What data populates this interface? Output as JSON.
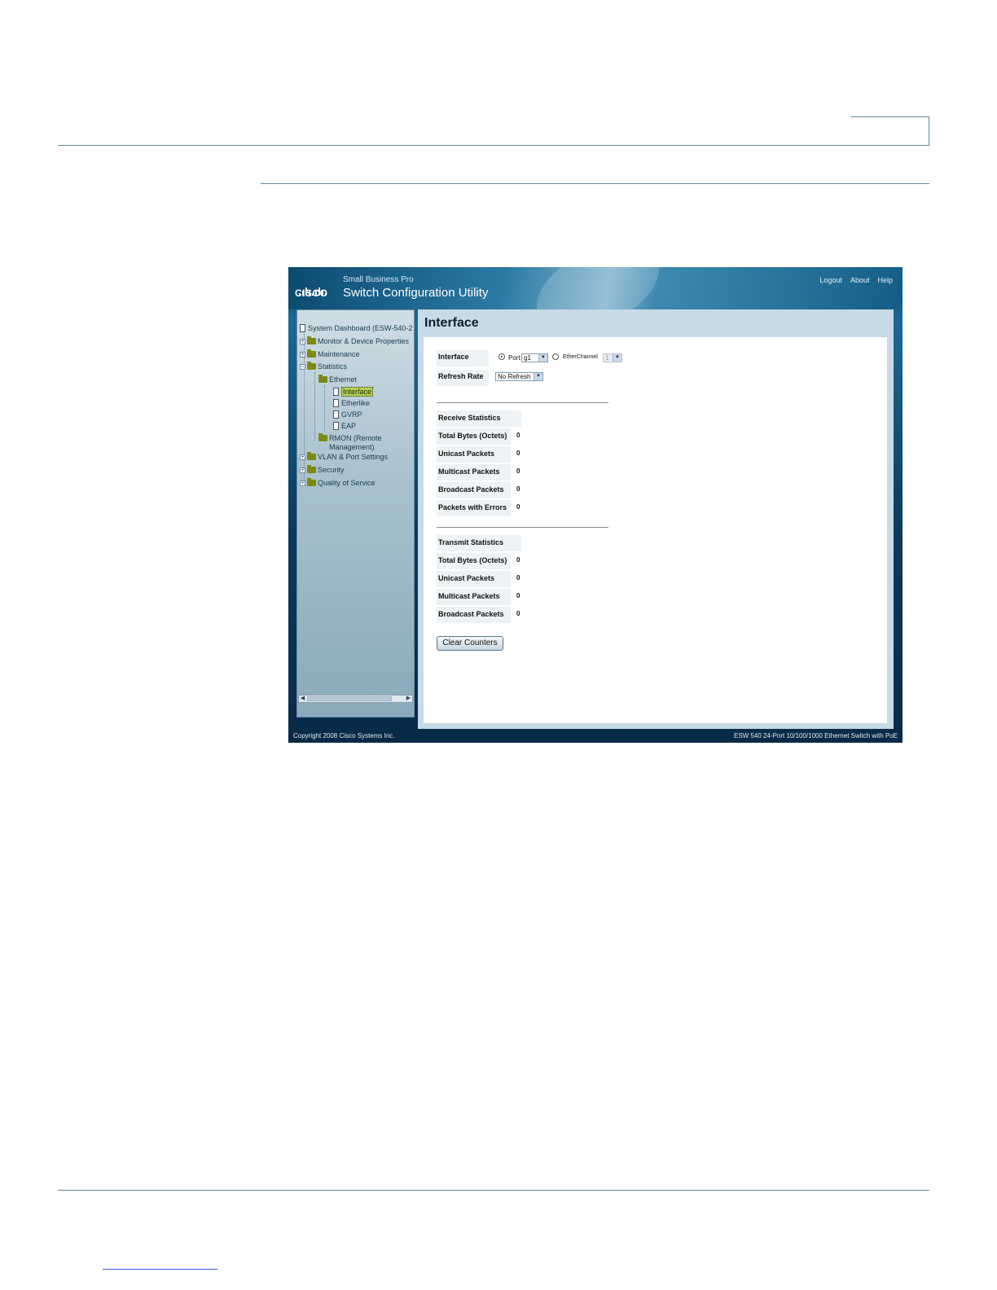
{
  "app": {
    "brand_small": "Small Business Pro",
    "brand_title": "Switch Configuration Utility",
    "logo_text": "CISCO",
    "top_links": [
      "Logout",
      "About",
      "Help"
    ]
  },
  "sidebar": {
    "root": "System Dashboard (ESW-540-2",
    "items": [
      {
        "label": "Monitor & Device Properties"
      },
      {
        "label": "Maintenance"
      },
      {
        "label": "Statistics"
      },
      {
        "label": "Ethernet"
      },
      {
        "label": "Interface"
      },
      {
        "label": "Etherlike"
      },
      {
        "label": "GVRP"
      },
      {
        "label": "EAP"
      },
      {
        "label": "RMON (Remote"
      },
      {
        "label": "Management)"
      },
      {
        "label": "VLAN & Port Settings"
      },
      {
        "label": "Security"
      },
      {
        "label": "Quality of Service"
      }
    ]
  },
  "main": {
    "title": "Interface",
    "interface_label": "Interface",
    "port_label": "Port",
    "port_value": "g1",
    "etherchannel_label": "EtherChannel",
    "etherchannel_value": "1",
    "refresh_label": "Refresh Rate",
    "refresh_value": "No Refresh",
    "receive": {
      "header": "Receive Statistics",
      "rows": [
        {
          "label": "Total Bytes (Octets)",
          "value": "0"
        },
        {
          "label": "Unicast Packets",
          "value": "0"
        },
        {
          "label": "Multicast Packets",
          "value": "0"
        },
        {
          "label": "Broadcast Packets",
          "value": "0"
        },
        {
          "label": "Packets with Errors",
          "value": "0"
        }
      ]
    },
    "transmit": {
      "header": "Transmit Statistics",
      "rows": [
        {
          "label": "Total Bytes (Octets)",
          "value": "0"
        },
        {
          "label": "Unicast Packets",
          "value": "0"
        },
        {
          "label": "Multicast Packets",
          "value": "0"
        },
        {
          "label": "Broadcast Packets",
          "value": "0"
        }
      ]
    },
    "clear_button": "Clear Counters"
  },
  "footer": {
    "copyright": "Copyright 2008 Cisco Systems Inc.",
    "model": "ESW 540 24-Port 10/100/1000 Ethernet Switch with PoE"
  }
}
